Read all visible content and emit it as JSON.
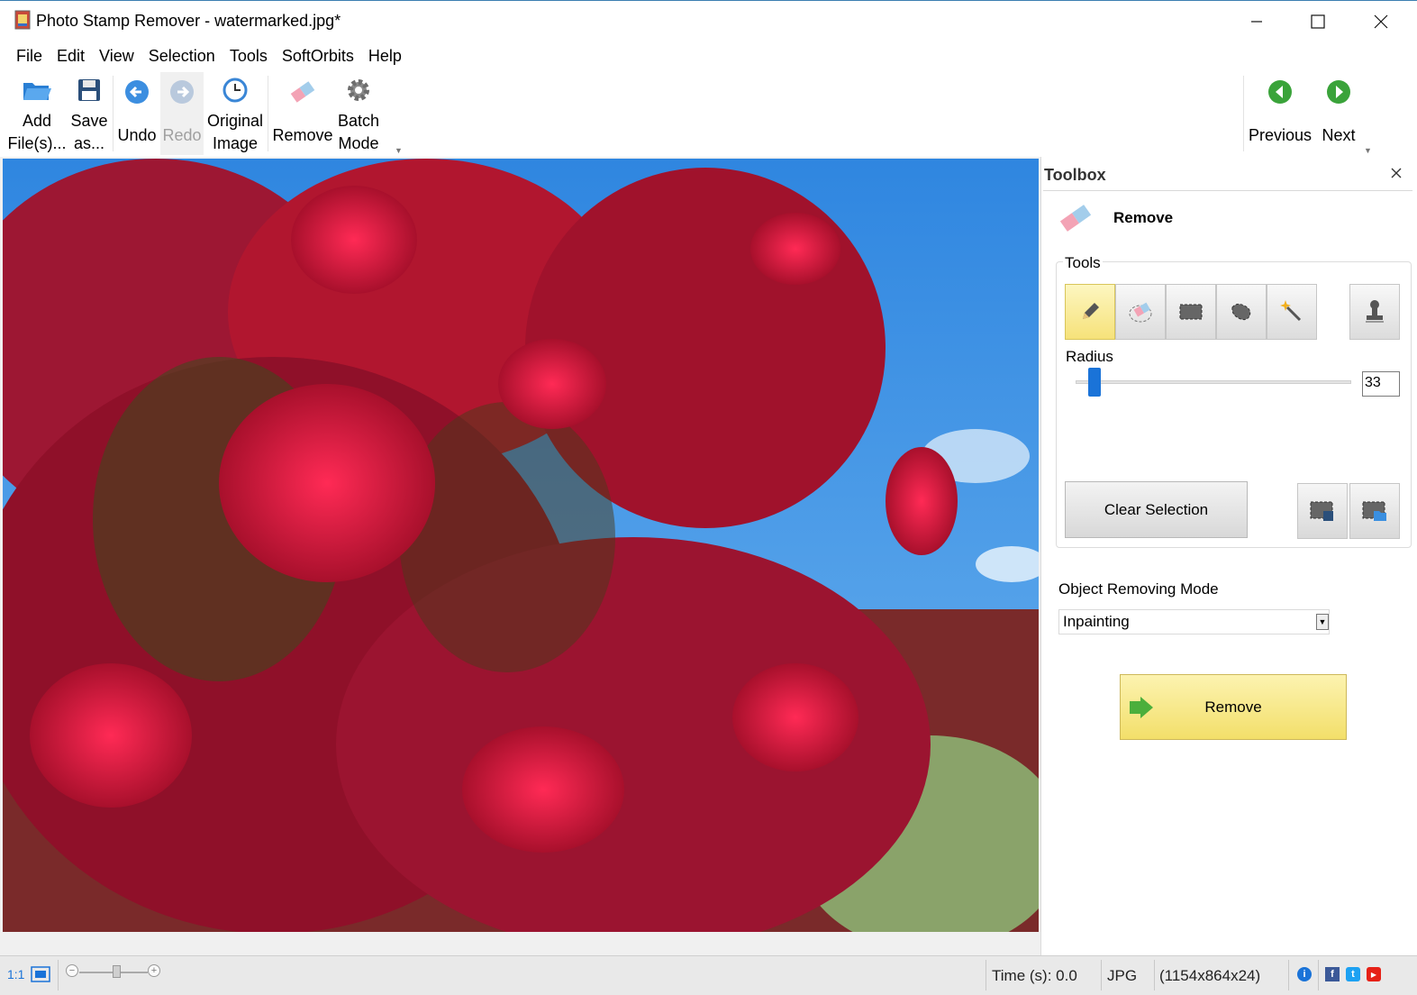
{
  "window": {
    "title": "Photo Stamp Remover - watermarked.jpg*"
  },
  "menu": [
    "File",
    "Edit",
    "View",
    "Selection",
    "Tools",
    "SoftOrbits",
    "Help"
  ],
  "toolbar": {
    "add_files": [
      "Add",
      "File(s)..."
    ],
    "save_as": [
      "Save",
      "as..."
    ],
    "undo": "Undo",
    "redo": "Redo",
    "original_image": [
      "Original",
      "Image"
    ],
    "remove": "Remove",
    "batch_mode": [
      "Batch",
      "Mode"
    ],
    "previous": "Previous",
    "next": "Next"
  },
  "toolbox": {
    "title": "Toolbox",
    "section": "Remove",
    "tools_label": "Tools",
    "radius_label": "Radius",
    "radius_value": "33",
    "radius_fraction": 0.07,
    "clear_selection": "Clear Selection",
    "mode_label": "Object Removing Mode",
    "mode_value": "Inpainting",
    "remove_button": "Remove"
  },
  "status": {
    "scale": "1:1",
    "time": "Time (s): 0.0",
    "format": "JPG",
    "dimensions": "(1154x864x24)"
  },
  "colors": {
    "accent": "#1a73d8",
    "remove_button": "#f3df6a",
    "active_tool": "#f6e27a",
    "nav_green": "#3aa33a"
  }
}
